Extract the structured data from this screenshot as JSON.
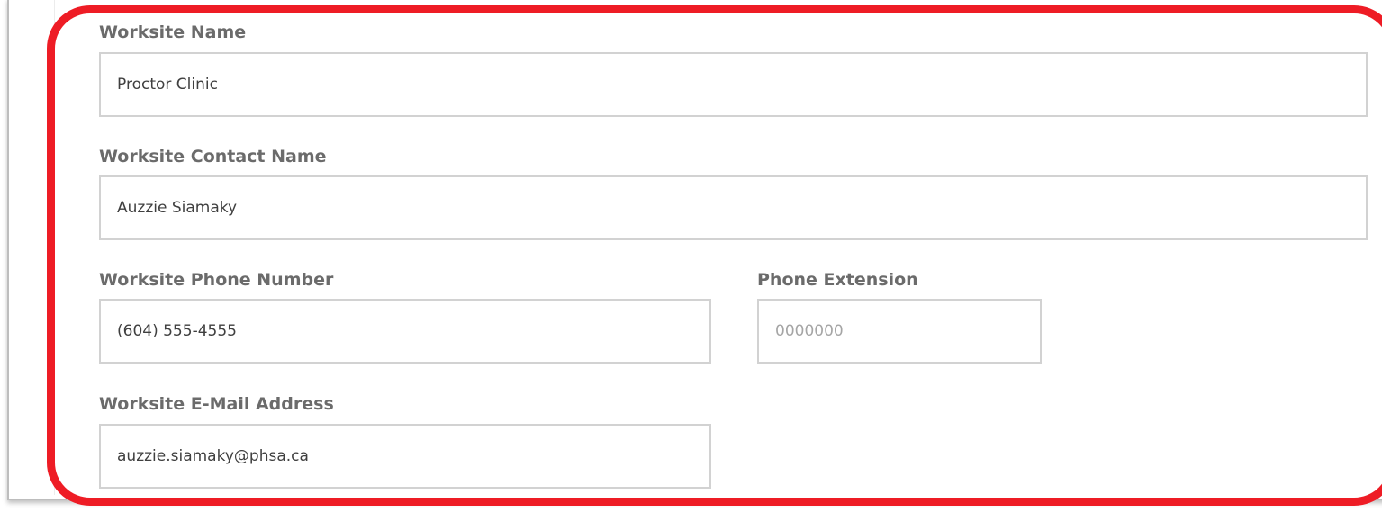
{
  "form": {
    "worksite_name": {
      "label": "Worksite Name",
      "value": "Proctor Clinic",
      "placeholder": ""
    },
    "contact_name": {
      "label": "Worksite Contact Name",
      "value": "Auzzie Siamaky",
      "placeholder": ""
    },
    "phone_number": {
      "label": "Worksite Phone Number",
      "value": "(604) 555-4555",
      "placeholder": ""
    },
    "phone_extension": {
      "label": "Phone Extension",
      "value": "",
      "placeholder": "0000000"
    },
    "email": {
      "label": "Worksite E-Mail Address",
      "value": "auzzie.siamaky@phsa.ca",
      "placeholder": ""
    }
  },
  "colors": {
    "highlight_border": "#ee1c25",
    "label_text": "#6b6b6b",
    "field_border": "#d2d2d2",
    "placeholder_text": "#a5a5a5"
  }
}
